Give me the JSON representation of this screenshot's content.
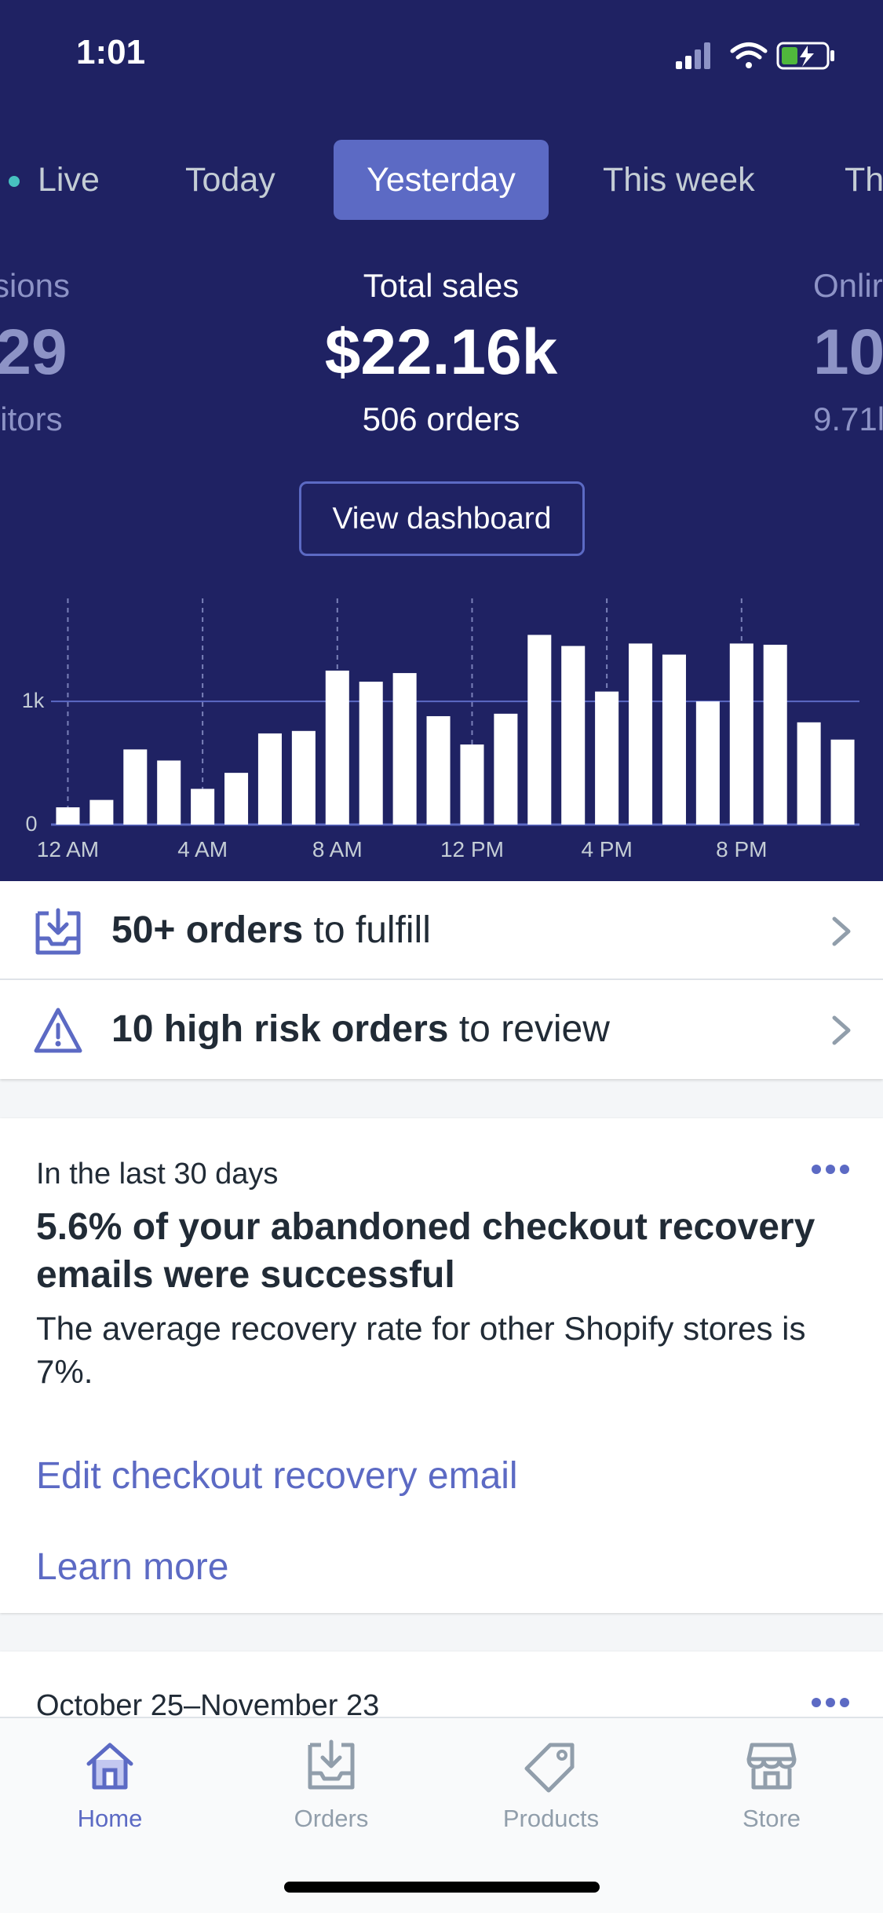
{
  "status_bar": {
    "time": "1:01"
  },
  "tabs": [
    {
      "label": "Live"
    },
    {
      "label": "Today"
    },
    {
      "label": "Yesterday",
      "active": true
    },
    {
      "label": "This week"
    },
    {
      "label": "Th"
    }
  ],
  "metrics": {
    "left": {
      "label": "sions",
      "value": "29",
      "sub": "itors"
    },
    "center": {
      "label": "Total sales",
      "value": "$22.16k",
      "sub": "506 orders"
    },
    "right": {
      "label": "Onlir",
      "value": "10",
      "sub": "9.71l"
    }
  },
  "dashboard_button": "View dashboard",
  "chart_data": {
    "type": "bar",
    "categories": [
      "12 AM",
      "1 AM",
      "2 AM",
      "3 AM",
      "4 AM",
      "5 AM",
      "6 AM",
      "7 AM",
      "8 AM",
      "9 AM",
      "10 AM",
      "11 AM",
      "12 PM",
      "1 PM",
      "2 PM",
      "3 PM",
      "4 PM",
      "5 PM",
      "6 PM",
      "7 PM",
      "8 PM",
      "9 PM",
      "10 PM",
      "11 PM"
    ],
    "values": [
      140,
      200,
      610,
      520,
      290,
      420,
      740,
      760,
      1250,
      1160,
      1230,
      880,
      650,
      900,
      1540,
      1450,
      1080,
      1470,
      1380,
      1000,
      1470,
      1460,
      830,
      690
    ],
    "x_tick_labels": [
      "12 AM",
      "4 AM",
      "8 AM",
      "12 PM",
      "4 PM",
      "8 PM"
    ],
    "y_tick_labels": [
      "0",
      "1k"
    ],
    "ylim": [
      0,
      1900
    ],
    "grid": true,
    "colors": {
      "bar": "#ffffff",
      "grid": "#5c6ac4",
      "vgrid": "#7a80b8",
      "text": "#c4cdd5"
    }
  },
  "alerts": [
    {
      "bold": "50+ orders",
      "rest": " to fulfill",
      "icon": "inbox-download-icon"
    },
    {
      "bold": "10 high risk orders",
      "rest": " to review",
      "icon": "warning-triangle-icon"
    }
  ],
  "insight_card": {
    "eyebrow": "In the last 30 days",
    "title": "5.6% of your abandoned checkout recovery emails were successful",
    "body": "The average recovery rate for other Shopify stores is 7%.",
    "link_primary": "Edit checkout recovery email",
    "link_secondary": "Learn more"
  },
  "second_card": {
    "title": "October 25–November 23"
  },
  "tab_bar": [
    {
      "label": "Home",
      "icon": "home-icon",
      "active": true
    },
    {
      "label": "Orders",
      "icon": "orders-icon"
    },
    {
      "label": "Products",
      "icon": "tag-icon"
    },
    {
      "label": "Store",
      "icon": "store-icon"
    }
  ],
  "colors": {
    "header_bg": "#1f2263",
    "accent": "#5c6ac4",
    "live_dot": "#47c1bf",
    "battery": "#50b83c"
  }
}
